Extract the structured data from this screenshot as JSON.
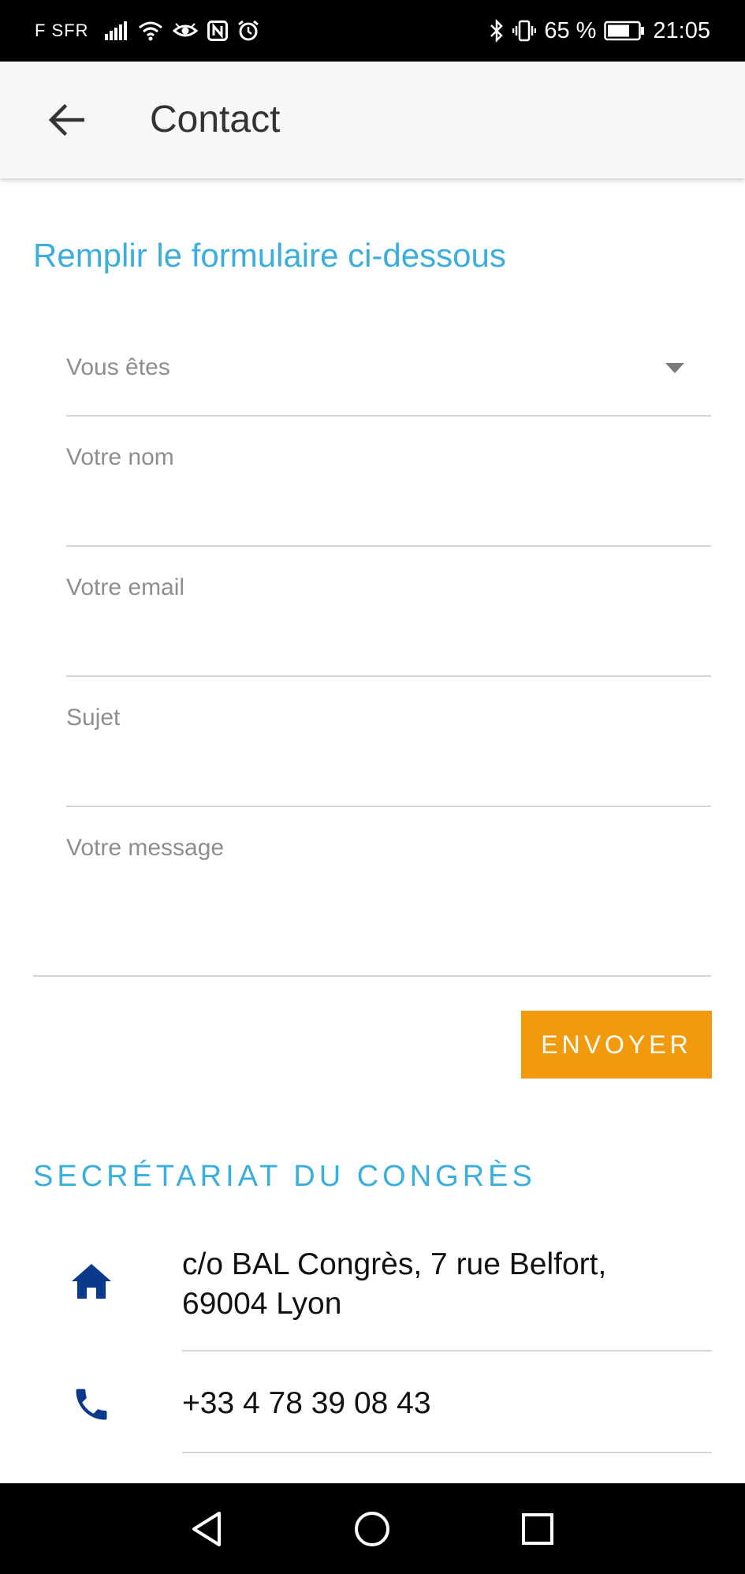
{
  "status_bar": {
    "carrier": "F SFR",
    "battery_percent": "65 %",
    "time": "21:05",
    "icons_left": [
      "signal-icon",
      "wifi-icon",
      "eye-icon",
      "nfc-icon",
      "alarm-icon"
    ],
    "icons_right": [
      "bluetooth-icon",
      "vibrate-icon",
      "battery-icon"
    ]
  },
  "app_bar": {
    "title": "Contact",
    "back_icon": "arrow-left-icon"
  },
  "form": {
    "heading": "Remplir le formulaire ci-dessous",
    "select_placeholder": "Vous êtes",
    "name_label": "Votre nom",
    "email_label": "Votre email",
    "subject_label": "Sujet",
    "message_label": "Votre message",
    "send_label": "ENVOYER"
  },
  "secretariat": {
    "heading": "SECRÉTARIAT DU CONGRÈS",
    "address_line1": "c/o BAL Congrès, 7 rue Belfort,",
    "address_line2": "69004 Lyon",
    "phone": "+33 4 78 39 08 43"
  },
  "colors": {
    "accent_blue": "#3aaedc",
    "button_orange": "#f39a0c",
    "icon_navy": "#0b3a8c"
  }
}
